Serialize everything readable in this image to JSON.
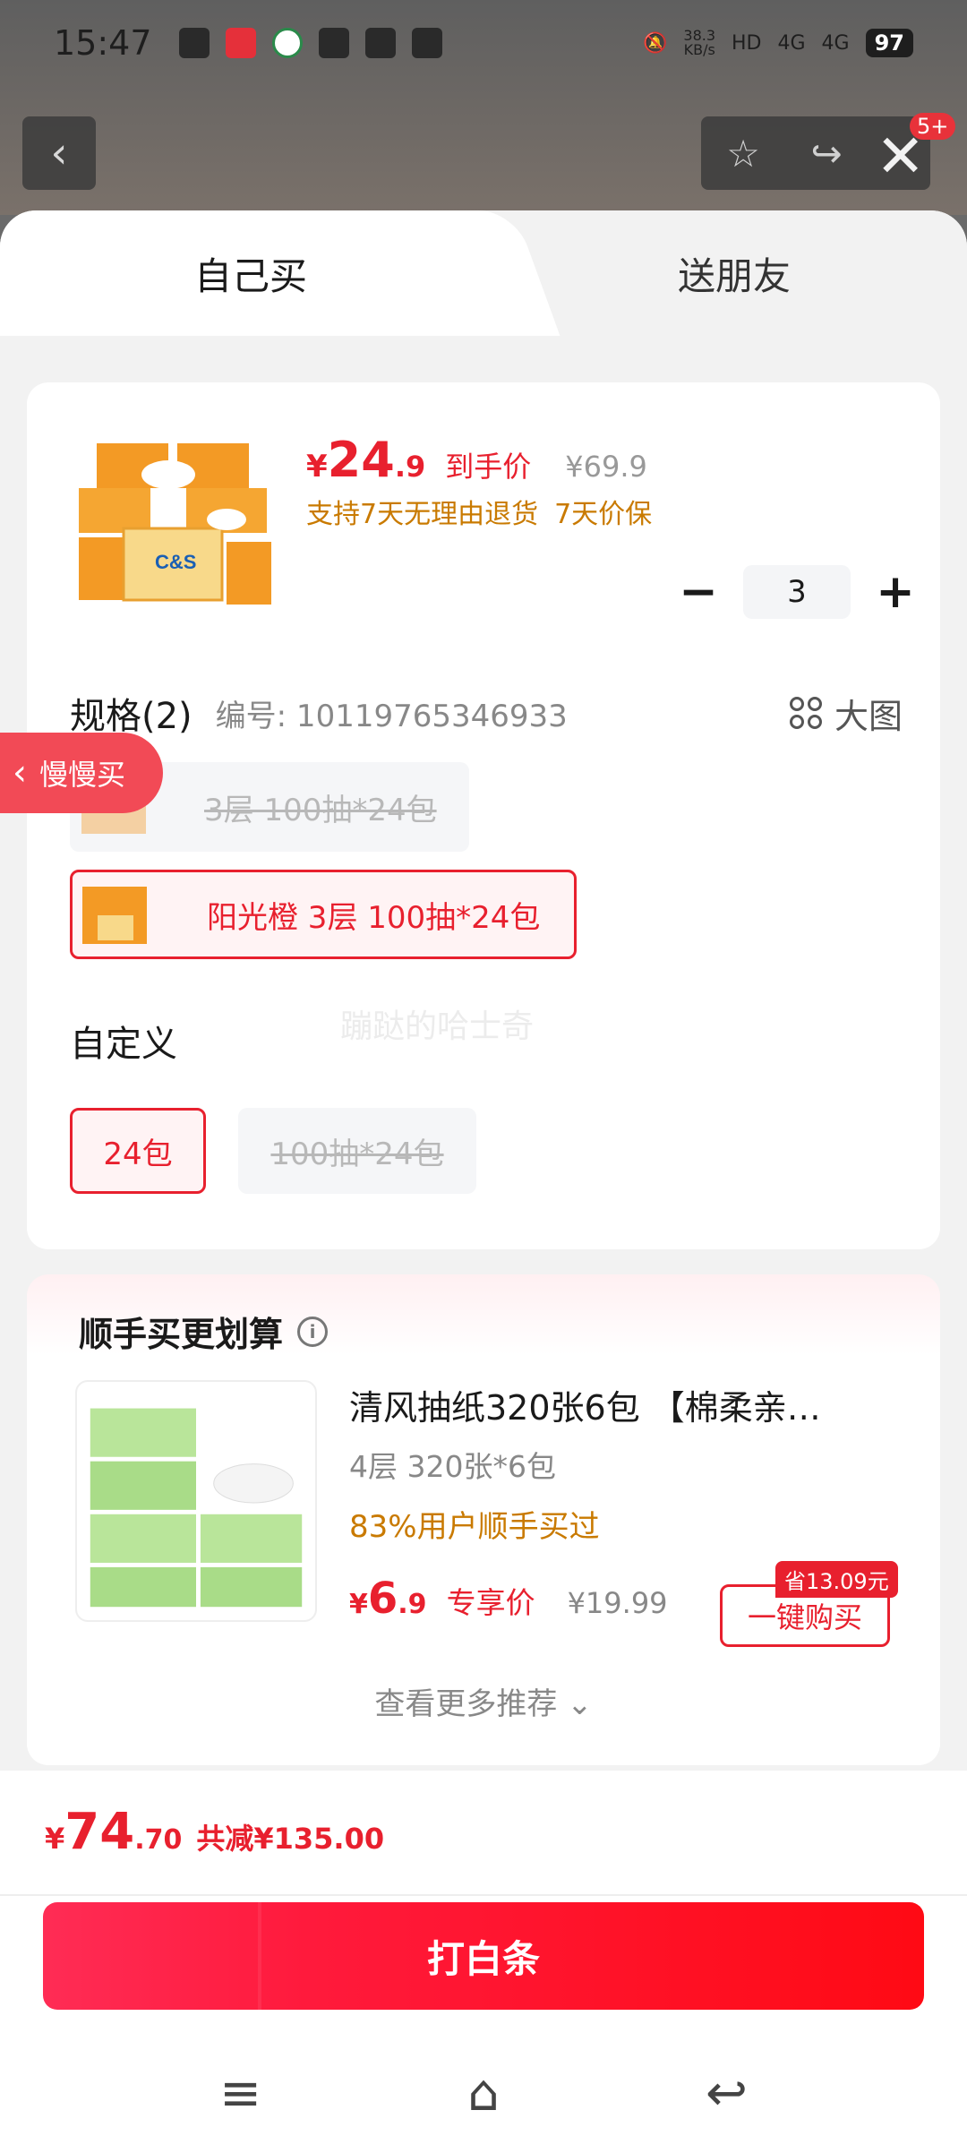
{
  "status_bar": {
    "time": "15:47",
    "net_speed": "38.3",
    "net_speed_unit": "KB/s",
    "hd": "HD",
    "signal1": "4G",
    "signal2": "4G",
    "battery": "97"
  },
  "top": {
    "notification_badge": "5+"
  },
  "tabs": {
    "self_buy": "自己买",
    "gift": "送朋友"
  },
  "product": {
    "price_symbol": "¥",
    "price_int": "24",
    "price_dec": ".9",
    "price_tag": "到手价",
    "original_price": "¥69.9",
    "service_1": "支持7天无理由退货",
    "service_2": "7天价保",
    "quantity": "3",
    "minus": "−",
    "plus": "+"
  },
  "spec": {
    "title": "规格(2)",
    "code": "编号: 10119765346933",
    "big_pic": "大图",
    "option_disabled": "3层 100抽*24包",
    "option_selected": "阳光橙 3层 100抽*24包"
  },
  "custom": {
    "title": "自定义",
    "option_selected": "24包",
    "option_disabled": "100抽*24包"
  },
  "watermark": "蹦跶的哈士奇",
  "slow_buy": "慢慢买",
  "recommend": {
    "title": "顺手买更划算",
    "name": "清风抽纸320张6包 【棉柔亲…",
    "spec": "4层 320张*6包",
    "social": "83%用户顺手买过",
    "price_symbol": "¥",
    "price_int": "6",
    "price_dec": ".9",
    "price_tag": "专享价",
    "original_price": "¥19.99",
    "save_badge": "省13.09元",
    "buy_button": "一键购买",
    "see_more": "查看更多推荐 ⌄"
  },
  "bottom": {
    "total_symbol": "¥",
    "total_int": "74",
    "total_dec": ".70",
    "reduce": "共减¥135.00",
    "pay_button": "打白条"
  },
  "colors": {
    "accent": "#e8202e",
    "warning": "#c97a00"
  }
}
